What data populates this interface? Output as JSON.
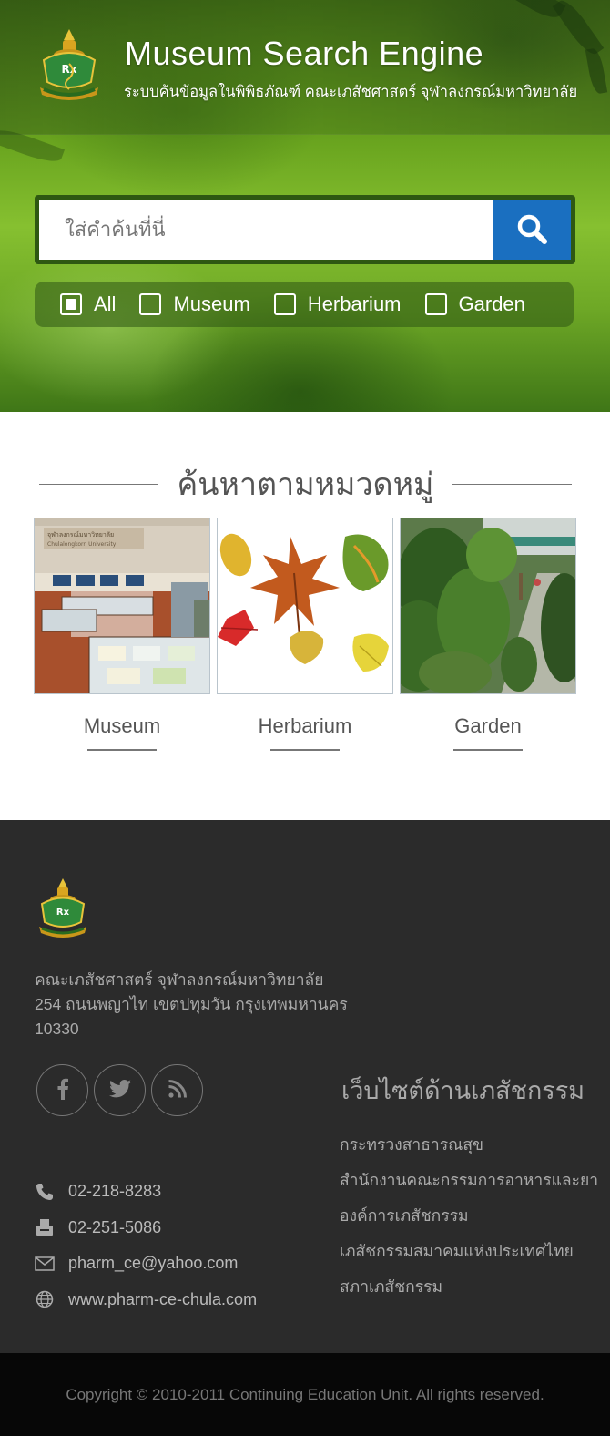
{
  "header": {
    "title": "Museum Search Engine",
    "subtitle": "ระบบค้นข้อมูลในพิพิธภัณฑ์ คณะเภสัชศาสตร์ จุฬาลงกรณ์มหาวิทยาลัย",
    "logo_text": "คณะเภสัชศาสตร์"
  },
  "search": {
    "placeholder": "ใส่คำค้นที่นี่",
    "value": "",
    "button_icon": "search-icon",
    "filters": [
      {
        "label": "All",
        "checked": true
      },
      {
        "label": "Museum",
        "checked": false
      },
      {
        "label": "Herbarium",
        "checked": false
      },
      {
        "label": "Garden",
        "checked": false
      }
    ]
  },
  "categories": {
    "heading": "ค้นหาตามหมวดหมู่",
    "items": [
      {
        "label": "Museum",
        "sign_text": "จุฬาลงกรณ์มหาวิทยาลัย",
        "sign_sub": "Chulalongkorn University"
      },
      {
        "label": "Herbarium"
      },
      {
        "label": "Garden"
      }
    ]
  },
  "footer": {
    "address_line1": "คณะเภสัชศาสตร์ จุฬาลงกรณ์มหาวิทยาลัย",
    "address_line2": "254 ถนนพญาไท เขตปทุมวัน กรุงเทพมหานคร",
    "address_line3": "10330",
    "social": [
      "facebook-icon",
      "twitter-icon",
      "rss-icon"
    ],
    "contacts": {
      "phone": "02-218-8283",
      "fax": "02-251-5086",
      "email": "pharm_ce@yahoo.com",
      "website": "www.pharm-ce-chula.com"
    },
    "links_title": "เว็บไซต์ด้านเภสัชกรรม",
    "links": [
      "กระทรวงสาธารณสุข",
      "สำนักงานคณะกรรมการอาหารและยา",
      "องค์การเภสัชกรรม",
      "เภสัชกรรมสมาคมแห่งประเทศไทย",
      "สภาเภสัชกรรม"
    ]
  },
  "copyright": "Copyright © 2010-2011 Continuing Education Unit. All rights reserved.",
  "colors": {
    "accent_blue": "#1a6fc0",
    "hero_green": "#6aa51f",
    "footer_bg": "#2b2b2b"
  }
}
